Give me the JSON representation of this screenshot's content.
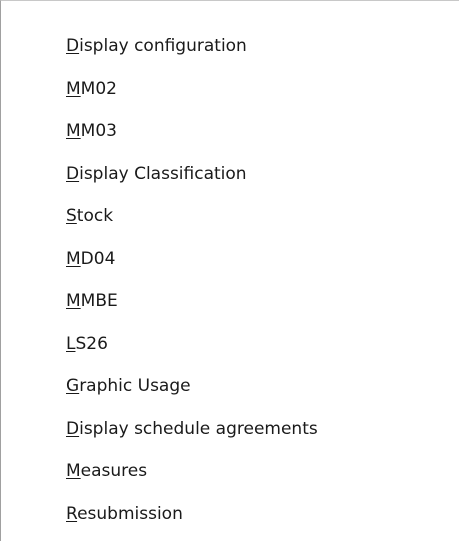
{
  "menu": {
    "items": [
      {
        "mnemonic": "D",
        "rest": "isplay configuration"
      },
      {
        "mnemonic": "M",
        "rest": "M02"
      },
      {
        "mnemonic": "M",
        "rest": "M03"
      },
      {
        "mnemonic": "D",
        "rest": "isplay Classification"
      },
      {
        "mnemonic": "S",
        "rest": "tock"
      },
      {
        "mnemonic": "M",
        "rest": "D04"
      },
      {
        "mnemonic": "M",
        "rest": "MBE"
      },
      {
        "mnemonic": "L",
        "rest": "S26"
      },
      {
        "mnemonic": "G",
        "rest": "raphic Usage"
      },
      {
        "mnemonic": "D",
        "rest": "isplay schedule agreements"
      },
      {
        "mnemonic": "M",
        "rest": "easures"
      },
      {
        "mnemonic": "R",
        "rest": "esubmission"
      }
    ]
  }
}
